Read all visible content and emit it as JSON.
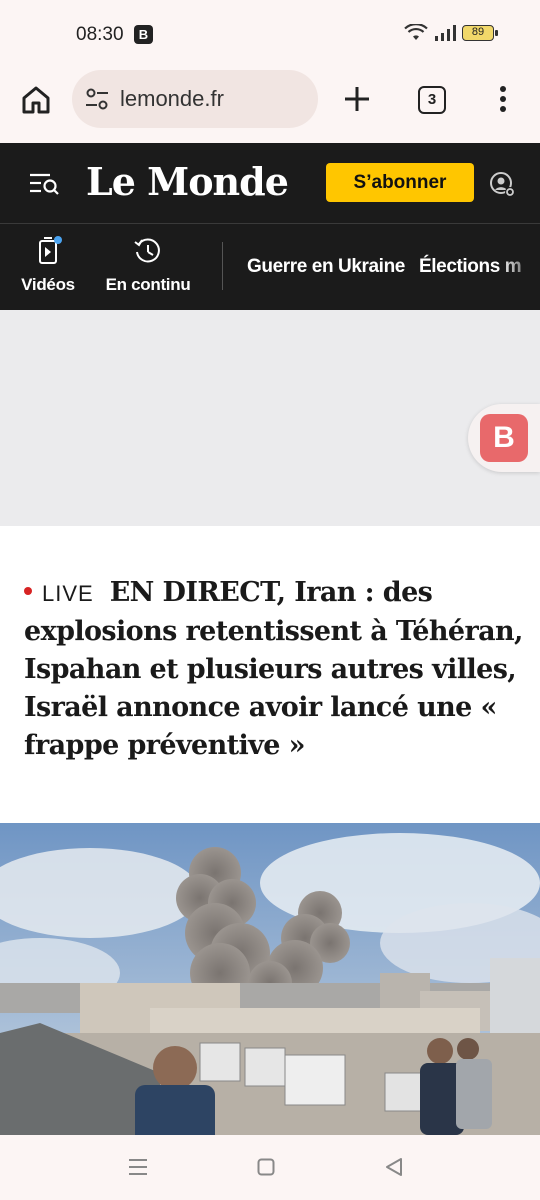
{
  "status_bar": {
    "time": "08:30",
    "notification_badge": "B",
    "battery_level": "89"
  },
  "browser": {
    "url": "lemonde.fr",
    "tab_count": "3",
    "icons": [
      "home-icon",
      "site-settings-icon",
      "plus-icon",
      "tab-switcher-icon",
      "more-vert-icon"
    ]
  },
  "site_header": {
    "logo": "Le Monde",
    "subscribe_label": "S’abonner",
    "icons": [
      "menu-search-icon",
      "account-settings-icon"
    ]
  },
  "nav": {
    "videos_label": "Vidéos",
    "continu_label": "En continu",
    "links": [
      "Guerre en Ukraine",
      "Élections m"
    ]
  },
  "floating_button": {
    "label": "B"
  },
  "article": {
    "live_label": "LIVE",
    "headline": "EN DIRECT, Iran : des explosions retentissent à Téhéran, Ispahan et plusieurs autres villes, Israël annonce avoir lancé une « frappe préventive »"
  },
  "colors": {
    "header_bg": "#1b1b1b",
    "subscribe_bg": "#ffc600",
    "live_dot": "#d72323",
    "floating_b": "#e8696b",
    "browser_bg": "#fcf5f4"
  }
}
